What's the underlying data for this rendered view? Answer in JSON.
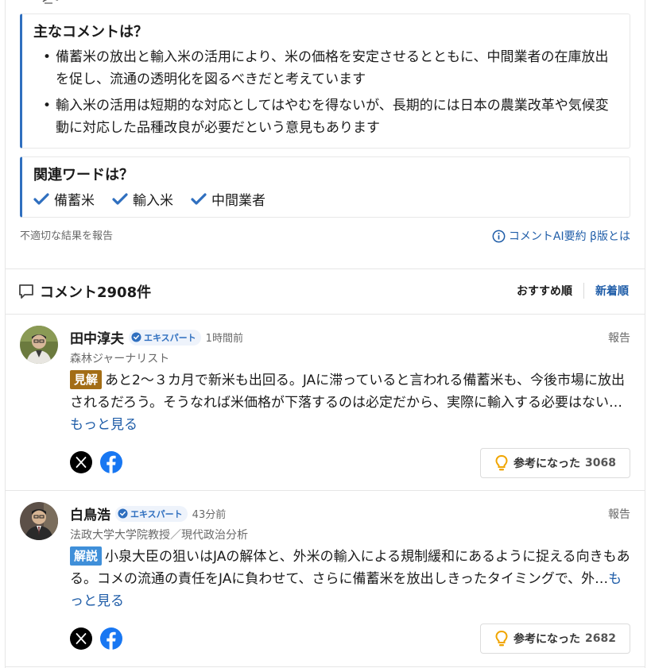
{
  "summary": {
    "heading": "主なコメントは？",
    "bullets": [
      "備蓄米の放出と輸入米の活用により、米の価格を安定させるとともに、中間業者の在庫放出を促し、流通の透明化を図るべきだと考えています",
      "輸入米の活用は短期的な対応としてはやむを得ないが、長期的には日本の農業改革や気候変動に対応した品種改良が必要だという意見もあります"
    ]
  },
  "related": {
    "heading": "関連ワードは？",
    "words": [
      "備蓄米",
      "輸入米",
      "中間業者"
    ]
  },
  "footer": {
    "report_label": "不適切な結果を報告",
    "ai_label": "コメントAI要約 β版とは"
  },
  "comments_section": {
    "title": "コメント2908件",
    "sort_recommended": "おすすめ順",
    "sort_newest": "新着順"
  },
  "comments": [
    {
      "name": "田中淳夫",
      "badge": "エキスパート",
      "time": "1時間前",
      "role": "森林ジャーナリスト",
      "report": "報告",
      "tag": "見解",
      "text": "あと2～３カ月で新米も出回る。JAに滞っていると言われる備蓄米も、今後市場に放出されるだろう。そうなれば米価格が下落するのは必定だから、実際に輸入する必要はない…",
      "more": "もっと見る",
      "helpful_label": "参考になった",
      "helpful_count": "3068"
    },
    {
      "name": "白鳥浩",
      "badge": "エキスパート",
      "time": "43分前",
      "role": "法政大学大学院教授／現代政治分析",
      "report": "報告",
      "tag": "解説",
      "text": "小泉大臣の狙いはJAの解体と、外米の輸入による規制緩和にあるように捉える向きもある。コメの流通の責任をJAに負わせて、さらに備蓄米を放出しきったタイミングで、外…",
      "more": "もっと見る",
      "helpful_label": "参考になった",
      "helpful_count": "2682"
    }
  ],
  "colors": {
    "accent_blue": "#2f6fbf",
    "link_blue": "#1f5da8",
    "tag_view": "#a36d15",
    "tag_explain": "#3f8fd9",
    "bulb": "#f0a500"
  },
  "icons": [
    "pen-icon",
    "check-icon",
    "info-icon",
    "comment-bubble-icon",
    "expert-check-icon",
    "x-icon",
    "facebook-icon",
    "lightbulb-icon"
  ]
}
